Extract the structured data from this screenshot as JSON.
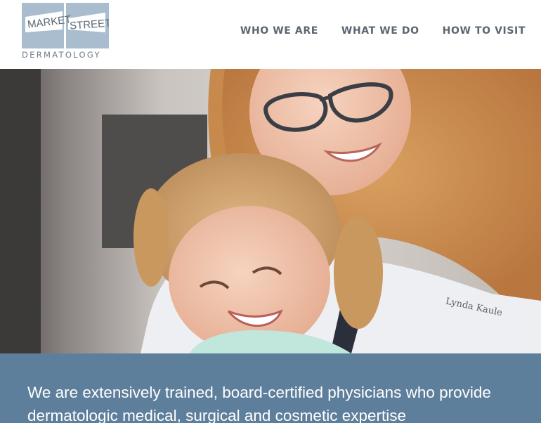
{
  "brand": {
    "logo_word_1": "MARKET",
    "logo_word_2": "STREET",
    "logo_word_3": "DERMATOLOGY"
  },
  "nav": {
    "items": [
      {
        "label": "WHO WE ARE"
      },
      {
        "label": "WHAT WE DO"
      },
      {
        "label": "HOW TO VISIT"
      }
    ]
  },
  "hero": {
    "coat_name": "Lynda Kaule"
  },
  "intro": {
    "text": "We are extensively trained, board-certified physicians who provide dermatologic medical, surgical and cosmetic expertise"
  },
  "colors": {
    "logo_tile": "#a9bdcf",
    "logo_text": "#5a6975",
    "nav_text": "#5b6671",
    "intro_band": "#5e7f9b",
    "intro_text": "#ffffff"
  }
}
